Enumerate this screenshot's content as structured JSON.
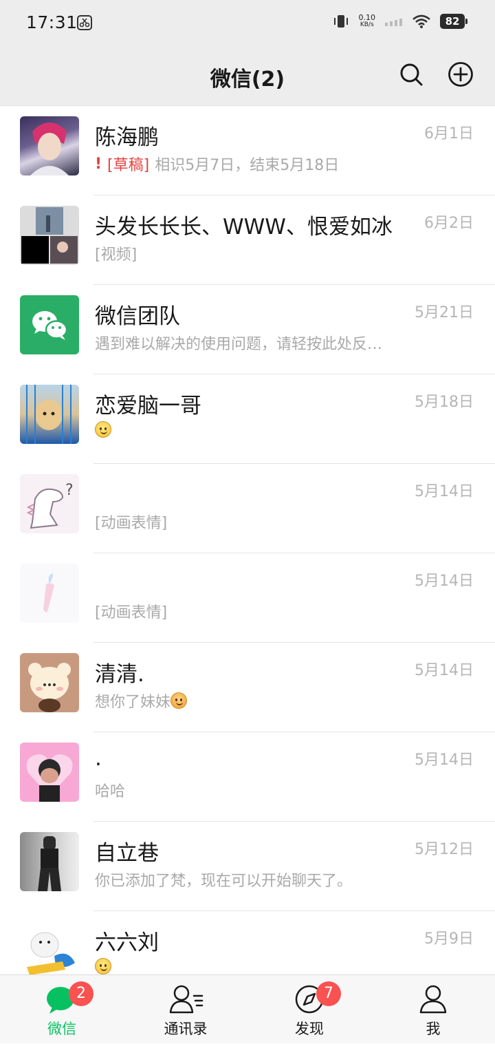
{
  "status_bar": {
    "time": "17:31",
    "net_speed_value": "0.10",
    "net_speed_unit": "KB/s",
    "battery": "82"
  },
  "header": {
    "title": "微信(2)"
  },
  "chats": [
    {
      "name": "陈海鹏",
      "time": "6月1日",
      "draft_mark": "!",
      "draft_tag": "[草稿]",
      "message": "相识5月7日，结束5月18日",
      "avatar_icon": "anime-boy-avatar"
    },
    {
      "name": "头发长长长、WWW、恨爱如冰",
      "time": "6月2日",
      "message": "[视频]",
      "avatar_icon": "group-collage-avatar"
    },
    {
      "name": "微信团队",
      "time": "5月21日",
      "message": "遇到难以解决的使用问题，请轻按此处反…",
      "avatar_icon": "wechat-logo-avatar"
    },
    {
      "name": "恋爱脑一哥",
      "time": "5月18日",
      "message": "",
      "emoji": "smile",
      "avatar_icon": "puppy-avatar"
    },
    {
      "name": "",
      "time": "5月14日",
      "message": "[动画表情]",
      "avatar_icon": "dinosaur-avatar"
    },
    {
      "name": "",
      "time": "5月14日",
      "message": "[动画表情]",
      "avatar_icon": "carrot-avatar"
    },
    {
      "name": "清清.",
      "time": "5月14日",
      "message": "想你了妹妹",
      "emoji": "angry",
      "avatar_icon": "bear-avatar"
    },
    {
      "name": ".",
      "time": "5月14日",
      "message": "哈哈",
      "avatar_icon": "pink-heart-avatar"
    },
    {
      "name": "自立巷",
      "time": "5月12日",
      "message": "你已添加了梵，现在可以开始聊天了。",
      "avatar_icon": "person-photo-avatar"
    },
    {
      "name": "六六刘",
      "time": "5月9日",
      "message": "",
      "emoji": "smile",
      "avatar_icon": "seal-avatar"
    }
  ],
  "tabbar": {
    "tabs": [
      {
        "label": "微信",
        "badge": "2",
        "icon": "chat-bubbles-icon",
        "active": true
      },
      {
        "label": "通讯录",
        "icon": "contacts-icon"
      },
      {
        "label": "发现",
        "badge": "7",
        "icon": "compass-icon"
      },
      {
        "label": "我",
        "icon": "person-icon"
      }
    ]
  },
  "colors": {
    "accent": "#07c160",
    "badge": "#fa5151",
    "draft": "#e64340",
    "header_bg": "#ededed"
  }
}
